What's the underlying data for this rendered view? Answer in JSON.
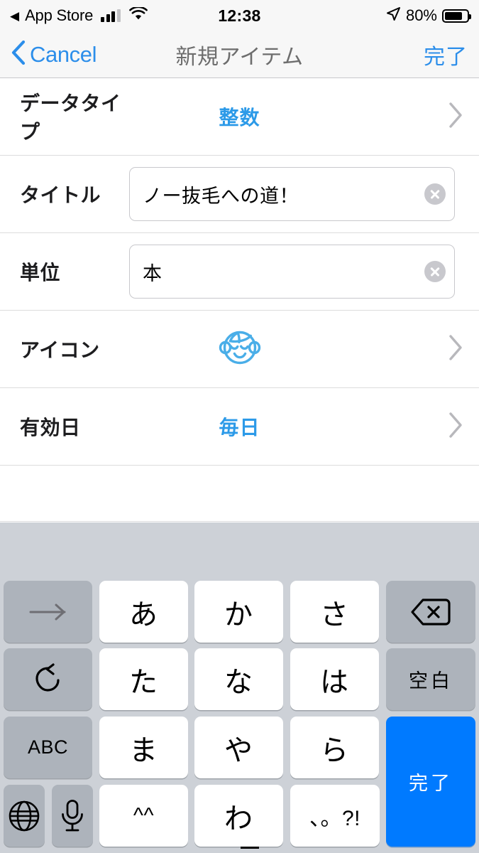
{
  "status_bar": {
    "back_arrow": "◀",
    "carrier": "App Store",
    "signal_icon": "cellular-signal-icon",
    "wifi_icon": "wifi-icon",
    "time": "12:38",
    "location_icon": "location-arrow-icon",
    "battery_percent": "80%",
    "battery_icon": "battery-icon",
    "battery_level": 80
  },
  "nav_bar": {
    "back_icon": "chevron-left-icon",
    "back_label": "Cancel",
    "title": "新規アイテム",
    "done_label": "完了",
    "accent_color": "#2c8eea",
    "title_color": "#6d6d6d"
  },
  "form": {
    "rows": [
      {
        "label": "データタイプ",
        "type": "disclosure",
        "value": "整数",
        "chevron_icon": "chevron-right-icon",
        "name": "data-type"
      },
      {
        "label": "タイトル",
        "type": "textfield",
        "value": "ノー抜毛への道！",
        "placeholder": "",
        "clear_icon": "clear-circle-icon",
        "name": "title"
      },
      {
        "label": "単位",
        "type": "textfield",
        "value": "本",
        "placeholder": "",
        "clear_icon": "clear-circle-icon",
        "name": "unit"
      },
      {
        "label": "アイコン",
        "type": "icon",
        "value_icon": "baby-face-icon",
        "icon_color": "#4aaee8",
        "chevron_icon": "chevron-right-icon",
        "name": "icon"
      },
      {
        "label": "有効日",
        "type": "disclosure",
        "value": "毎日",
        "chevron_icon": "chevron-right-icon",
        "name": "valid-days"
      }
    ],
    "value_color": "#2c9ae8"
  },
  "keyboard": {
    "background_color": "#cdd1d7",
    "keys": [
      {
        "id": "next-candidate",
        "label": "→",
        "kind": "grey",
        "glyph": "arrow-right-icon",
        "row": 0,
        "col": 0
      },
      {
        "id": "kana-a",
        "label": "あ",
        "kind": "white",
        "row": 0,
        "col": 1
      },
      {
        "id": "kana-ka",
        "label": "か",
        "kind": "white",
        "row": 0,
        "col": 2
      },
      {
        "id": "kana-sa",
        "label": "さ",
        "kind": "white",
        "row": 0,
        "col": 3
      },
      {
        "id": "delete",
        "label": "",
        "kind": "grey",
        "glyph": "delete-backward-icon",
        "row": 0,
        "col": 4
      },
      {
        "id": "undo",
        "label": "",
        "kind": "grey",
        "glyph": "undo-arrow-icon",
        "row": 1,
        "col": 0
      },
      {
        "id": "kana-ta",
        "label": "た",
        "kind": "white",
        "row": 1,
        "col": 1
      },
      {
        "id": "kana-na",
        "label": "な",
        "kind": "white",
        "row": 1,
        "col": 2
      },
      {
        "id": "kana-ha",
        "label": "は",
        "kind": "white",
        "row": 1,
        "col": 3
      },
      {
        "id": "space",
        "label": "空白",
        "kind": "grey",
        "row": 1,
        "col": 4
      },
      {
        "id": "abc",
        "label": "ABC",
        "kind": "grey",
        "row": 2,
        "col": 0
      },
      {
        "id": "kana-ma",
        "label": "ま",
        "kind": "white",
        "row": 2,
        "col": 1
      },
      {
        "id": "kana-ya",
        "label": "や",
        "kind": "white",
        "row": 2,
        "col": 2
      },
      {
        "id": "kana-ra",
        "label": "ら",
        "kind": "white",
        "row": 2,
        "col": 3
      },
      {
        "id": "return-done",
        "label": "完了",
        "kind": "blue",
        "row": 2,
        "col": 4
      },
      {
        "id": "globe",
        "label": "",
        "kind": "grey",
        "glyph": "globe-icon",
        "row": 3,
        "col": 0
      },
      {
        "id": "dictation",
        "label": "",
        "kind": "grey",
        "glyph": "microphone-icon",
        "row": 3,
        "col": 1
      },
      {
        "id": "emoticon",
        "label": "^^",
        "kind": "white",
        "row": 3,
        "col": 2
      },
      {
        "id": "kana-wa",
        "label": "わ",
        "kind": "white",
        "row": 3,
        "col": 3
      },
      {
        "id": "punctuation",
        "label": "、。?!",
        "kind": "white",
        "row": 3,
        "col": 4
      }
    ]
  }
}
